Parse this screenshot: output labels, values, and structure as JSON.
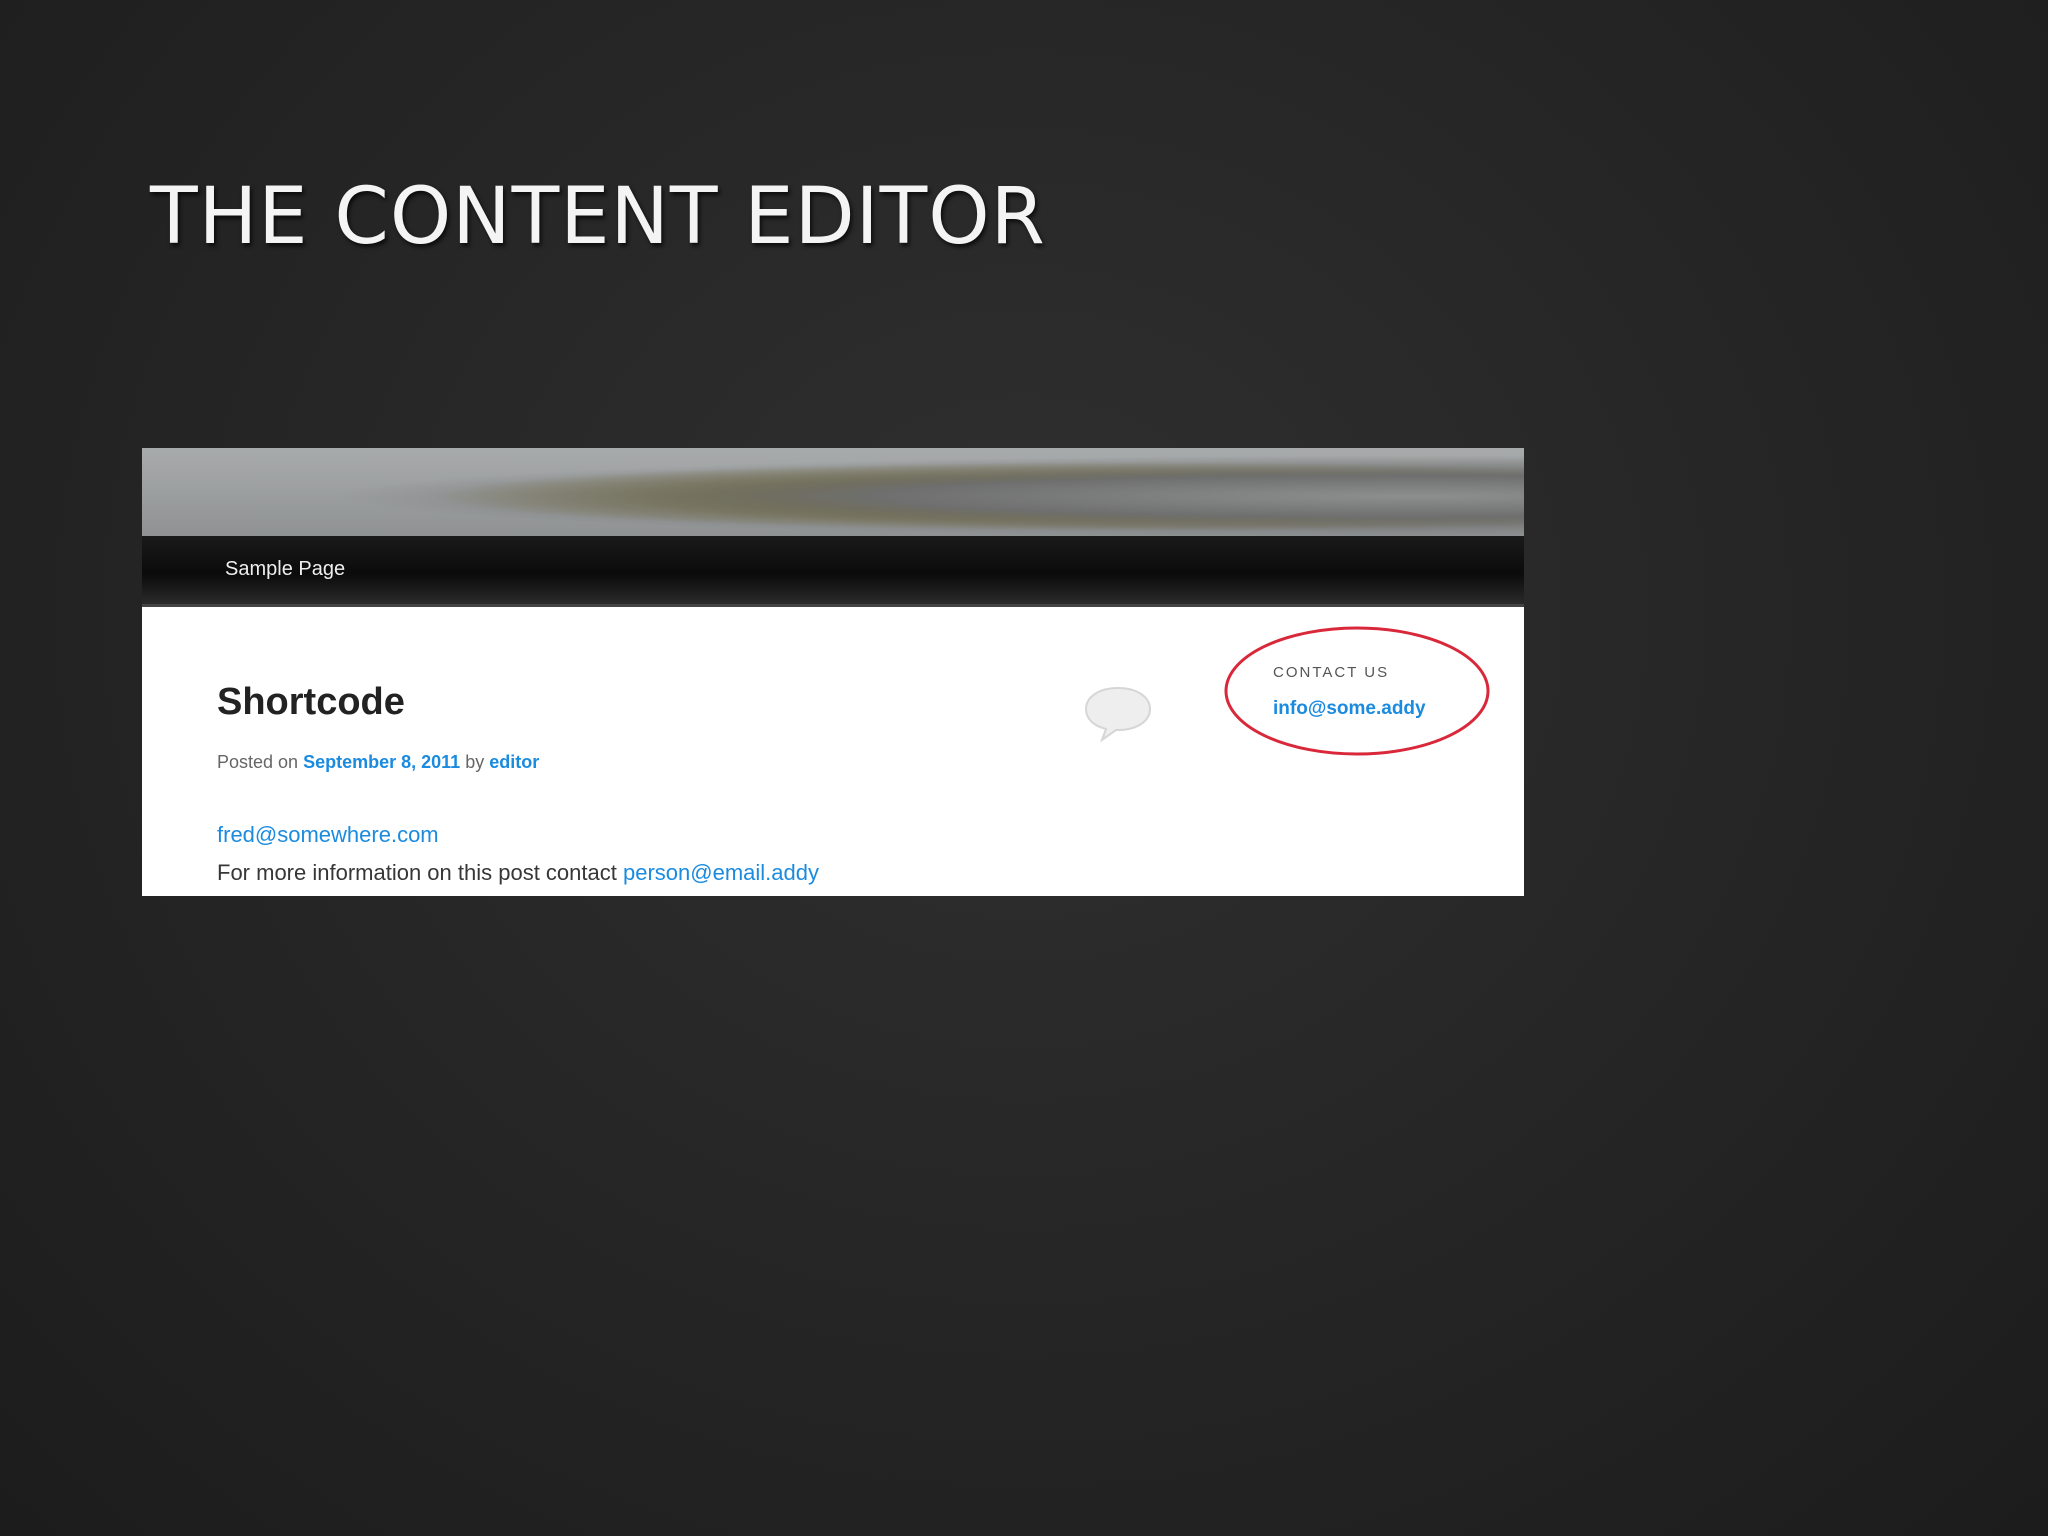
{
  "slide": {
    "title": "THE CONTENT EDITOR"
  },
  "site": {
    "nav": {
      "items": [
        "Sample Page"
      ]
    }
  },
  "post": {
    "title": "Shortcode",
    "meta": {
      "prefix": "Posted on",
      "date": "September 8, 2011",
      "by": "by",
      "author": "editor"
    },
    "body": {
      "line1_link": "fred@somewhere.com",
      "line2_text": "For more information on this post contact",
      "line2_link": "person@email.addy"
    }
  },
  "widget": {
    "heading": "CONTACT US",
    "email": "info@some.addy"
  },
  "colors": {
    "link": "#1b8be0",
    "highlight": "#d8283a"
  },
  "icons": {
    "comment": "speech-bubble-icon"
  }
}
